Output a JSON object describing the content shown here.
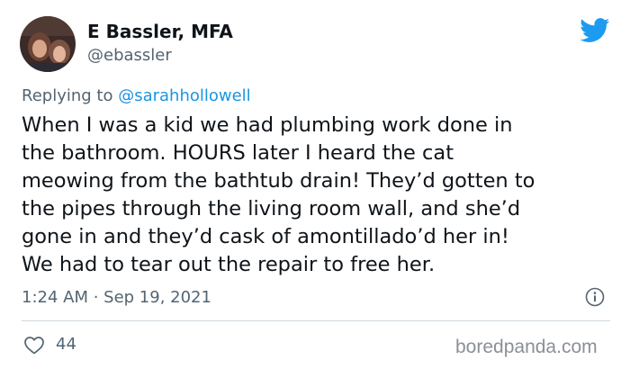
{
  "author": {
    "display_name": "E Bassler, MFA",
    "handle": "@ebassler"
  },
  "reply": {
    "prefix": "Replying to ",
    "to": "@sarahhollowell"
  },
  "tweet": {
    "lines": [
      "When I was a kid we had plumbing work done in",
      "the bathroom. HOURS later I heard the cat",
      "meowing from the bathtub drain! They’d gotten to",
      "the pipes through the living room wall, and she’d",
      "gone in and they’d cask of amontillado’d her in!",
      "We had to tear out the repair to free her."
    ]
  },
  "meta": {
    "timestamp": "1:24 AM · Sep 19, 2021"
  },
  "actions": {
    "like_count": "44"
  },
  "watermark": "boredpanda.com",
  "colors": {
    "twitter_blue": "#1d9bf0",
    "link_blue": "#1b95e0",
    "muted_text": "#536471",
    "primary_text": "#0f1419"
  },
  "icons": {
    "brand": "twitter-bird-icon",
    "info": "info-icon",
    "like": "heart-icon"
  }
}
